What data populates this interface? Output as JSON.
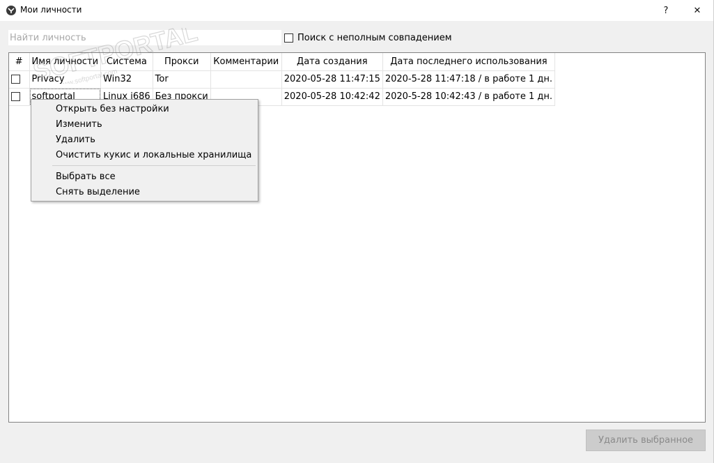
{
  "window": {
    "title": "Мои личности",
    "help_label": "?",
    "close_label": "✕"
  },
  "search": {
    "placeholder": "Найти личность",
    "value": ""
  },
  "partial_match": {
    "label": "Поиск с неполным совпадением",
    "checked": false
  },
  "table": {
    "columns": [
      "#",
      "Имя личности",
      "Система",
      "Прокси",
      "Комментарии",
      "Дата создания",
      "Дата последнего использования"
    ],
    "rows": [
      {
        "name": "Privacy",
        "system": "Win32",
        "proxy": "Tor",
        "comment": "",
        "created": "2020-05-28 11:47:15",
        "last_used": "2020-5-28 11:47:18 / в работе 1 дн."
      },
      {
        "name": "softportal",
        "system": "Linux i686",
        "proxy": "Без прокси",
        "comment": "",
        "created": "2020-05-28 10:42:42",
        "last_used": "2020-5-28 10:42:43 / в работе 1 дн."
      }
    ]
  },
  "context_menu": {
    "items": [
      "Открыть без настройки",
      "Изменить",
      "Удалить",
      "Очистить кукис и локальные хранилища",
      "Выбрать все",
      "Снять выделение"
    ]
  },
  "footer": {
    "delete_selected_label": "Удалить выбранное"
  },
  "watermark": {
    "text": "SOFTPORTAL",
    "url": "www.softportal.com"
  }
}
